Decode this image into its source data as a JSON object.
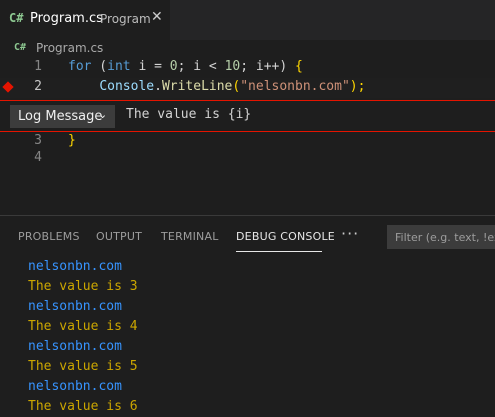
{
  "tab": {
    "icon": "C#",
    "title": "Program.cs",
    "description": "Program",
    "close": "✕"
  },
  "breadcrumb": {
    "icon": "C#",
    "file": "Program.cs"
  },
  "editor": {
    "lines": [
      {
        "number": "1"
      },
      {
        "number": "2"
      },
      {
        "number": "3"
      },
      {
        "number": "4"
      }
    ],
    "line1": {
      "kw_for": "for",
      "open": " (",
      "kw_int": "int",
      "sp_i": " i = ",
      "zero": "0",
      "cond": "; i < ",
      "ten": "10",
      "inc": "; i++) ",
      "brace": "{"
    },
    "line2": {
      "indent": "    ",
      "cls": "Console",
      "dot": ".",
      "fn": "WriteLine",
      "open": "(",
      "str": "\"nelsonbn.com\"",
      "close": ");"
    },
    "line3": {
      "brace": "}"
    }
  },
  "breakpoint_widget": {
    "type_label": "Log Message",
    "chevron": "⌄",
    "message": "The value is {i}",
    "colors": {
      "border": "#e51400"
    }
  },
  "panel": {
    "tabs": [
      {
        "label": "PROBLEMS"
      },
      {
        "label": "OUTPUT"
      },
      {
        "label": "TERMINAL"
      },
      {
        "label": "DEBUG CONSOLE"
      }
    ],
    "more": "···",
    "filter_placeholder": "Filter (e.g. text, !exclude)",
    "console_lines": [
      "nelsonbn.com",
      "The value is 3",
      "nelsonbn.com",
      "The value is 4",
      "nelsonbn.com",
      "The value is 5",
      "nelsonbn.com",
      "The value is 6"
    ]
  }
}
